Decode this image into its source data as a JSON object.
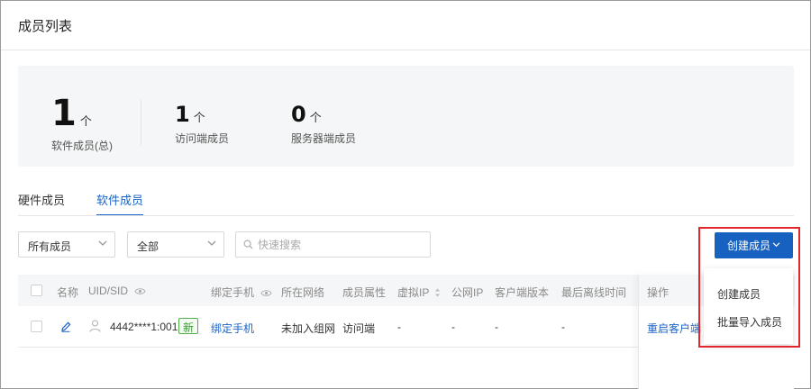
{
  "page": {
    "title": "成员列表"
  },
  "stats": [
    {
      "value": "1",
      "unit": "个",
      "label": "软件成员(总)"
    },
    {
      "value": "1",
      "unit": "个",
      "label": "访问端成员"
    },
    {
      "value": "0",
      "unit": "个",
      "label": "服务器端成员"
    }
  ],
  "tabs": [
    {
      "label": "硬件成员",
      "active": false
    },
    {
      "label": "软件成员",
      "active": true
    }
  ],
  "filters": {
    "member_scope": "所有成员",
    "attribute": "全部",
    "search_placeholder": "快速搜索"
  },
  "create_button": {
    "label": "创建成员"
  },
  "create_menu": {
    "items": [
      "创建成员",
      "批量导入成员"
    ]
  },
  "table": {
    "columns": [
      "名称",
      "UID/SID",
      "绑定手机",
      "所在网络",
      "成员属性",
      "虚拟IP",
      "公网IP",
      "客户端版本",
      "最后离线时间",
      "操作"
    ],
    "rows": [
      {
        "uid": "4442****1:001",
        "badge": "新",
        "phone": "绑定手机",
        "network": "未加入组网",
        "attribute": "访问端",
        "virtual_ip": "-",
        "public_ip": "-",
        "client_version": "-",
        "last_offline": "-",
        "action": "重启客户端"
      }
    ]
  },
  "colors": {
    "accent": "#1c64c6",
    "primary_button": "#1761c0",
    "highlight": "#e3262e",
    "badge": "#52b14a"
  }
}
